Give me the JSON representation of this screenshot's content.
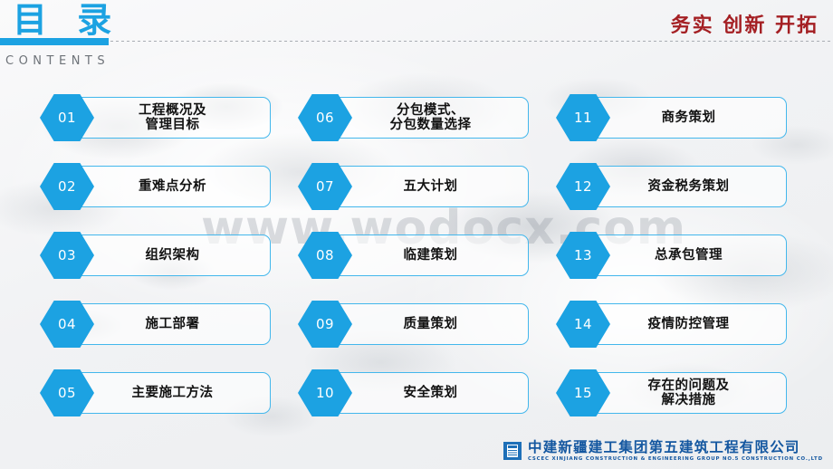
{
  "header": {
    "title_cn": "目  录",
    "title_en": "CONTENTS",
    "slogan": "务实  创新  开拓",
    "accent_color": "#1CA2E2",
    "slogan_color": "#A41F23"
  },
  "watermark": "www.wodocx.com",
  "columns": [
    {
      "items": [
        {
          "number": "01",
          "label": "工程概况及\n管理目标",
          "lines": 2
        },
        {
          "number": "02",
          "label": "重难点分析",
          "lines": 1
        },
        {
          "number": "03",
          "label": "组织架构",
          "lines": 1
        },
        {
          "number": "04",
          "label": "施工部署",
          "lines": 1
        },
        {
          "number": "05",
          "label": "主要施工方法",
          "lines": 1
        }
      ]
    },
    {
      "items": [
        {
          "number": "06",
          "label": "分包模式、\n分包数量选择",
          "lines": 2
        },
        {
          "number": "07",
          "label": "五大计划",
          "lines": 1
        },
        {
          "number": "08",
          "label": "临建策划",
          "lines": 1
        },
        {
          "number": "09",
          "label": "质量策划",
          "lines": 1
        },
        {
          "number": "10",
          "label": "安全策划",
          "lines": 1
        }
      ]
    },
    {
      "items": [
        {
          "number": "11",
          "label": "商务策划",
          "lines": 1
        },
        {
          "number": "12",
          "label": "资金税务策划",
          "lines": 1
        },
        {
          "number": "13",
          "label": "总承包管理",
          "lines": 1
        },
        {
          "number": "14",
          "label": "疫情防控管理",
          "lines": 1
        },
        {
          "number": "15",
          "label": "存在的问题及\n解决措施",
          "lines": 2
        }
      ]
    }
  ],
  "footer": {
    "company_cn": "中建新疆建工集团第五建筑工程有限公司",
    "company_en": "CSCEC XINJIANG CONSTRUCTION & ENGINEERING GROUP NO.5 CONSTRUCTION CO.,LTD",
    "logo_color": "#1457A0"
  }
}
